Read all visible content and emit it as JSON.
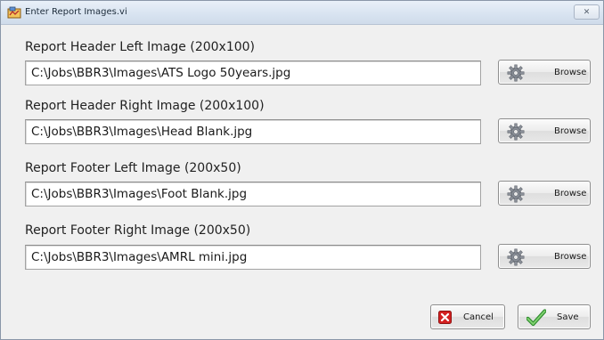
{
  "window": {
    "title": "Enter Report Images.vi",
    "close_glyph": "✕"
  },
  "fields": [
    {
      "label": "Report Header Left Image (200x100)",
      "value": "C:\\Jobs\\BBR3\\Images\\ATS Logo 50years.jpg",
      "button": "Browse"
    },
    {
      "label": "Report Header Right Image (200x100)",
      "value": "C:\\Jobs\\BBR3\\Images\\Head Blank.jpg",
      "button": "Browse"
    },
    {
      "label": "Report Footer Left Image (200x50)",
      "value": "C:\\Jobs\\BBR3\\Images\\Foot Blank.jpg",
      "button": "Browse"
    },
    {
      "label": "Report Footer Right Image (200x50)",
      "value": "C:\\Jobs\\BBR3\\Images\\AMRL mini.jpg",
      "button": "Browse"
    }
  ],
  "footer": {
    "cancel_label": "Cancel",
    "save_label": "Save"
  },
  "icons": {
    "app": "labview-vi-icon",
    "browse": "gear-icon",
    "cancel": "red-x-icon",
    "save": "green-checkmark-icon",
    "close": "close-icon"
  },
  "colors": {
    "cancel_icon": "#d42020",
    "save_icon": "#3aa33a",
    "gear_icon": "#8a8f98"
  }
}
